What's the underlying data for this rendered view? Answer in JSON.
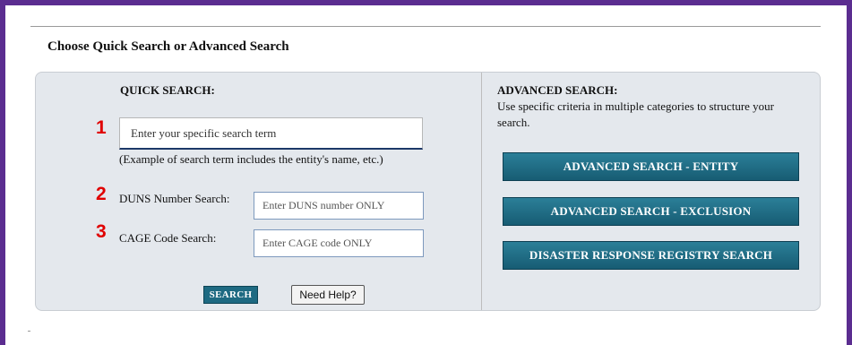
{
  "page": {
    "title": "Choose Quick Search or Advanced Search"
  },
  "markers": [
    "1",
    "2",
    "3"
  ],
  "quick_search": {
    "heading": "QUICK SEARCH:",
    "main_input": {
      "placeholder": "Enter your specific search term",
      "value": ""
    },
    "example_note": "(Example of search term includes the entity's name, etc.)",
    "duns": {
      "label": "DUNS Number Search:",
      "placeholder": "Enter DUNS number ONLY",
      "value": ""
    },
    "cage": {
      "label": "CAGE Code Search:",
      "placeholder": "Enter CAGE code ONLY",
      "value": ""
    },
    "search_button": "SEARCH",
    "help_button": "Need Help?"
  },
  "advanced_search": {
    "heading": "ADVANCED SEARCH:",
    "description": "Use specific criteria in multiple categories to structure your search.",
    "buttons": [
      "ADVANCED SEARCH - ENTITY",
      "ADVANCED SEARCH - EXCLUSION",
      "DISASTER RESPONSE REGISTRY SEARCH"
    ]
  },
  "colors": {
    "frame_border": "#5b2d90",
    "panel_bg": "#e4e8ed",
    "button_teal": "#1e6a82",
    "marker_red": "#e00000"
  }
}
